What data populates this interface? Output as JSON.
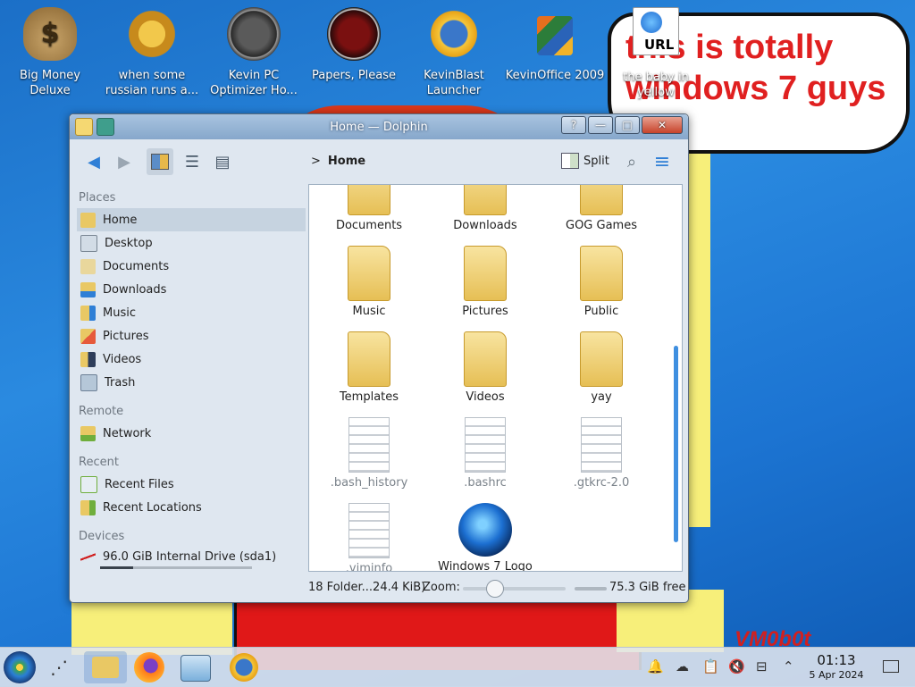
{
  "desktop_icons": [
    {
      "label": "Big Money Deluxe",
      "icon": "money-bag-icon"
    },
    {
      "label": "when some russian runs a...",
      "icon": "gear-icon"
    },
    {
      "label": "Kevin PC Optimizer Ho...",
      "icon": "gauge-icon"
    },
    {
      "label": "Papers, Please",
      "icon": "papers-please-icon"
    },
    {
      "label": "KevinBlast Launcher",
      "icon": "blast-launcher-icon"
    },
    {
      "label": "KevinOffice 2009",
      "icon": "office-icon"
    },
    {
      "label": "the baby in yellow",
      "icon": "url-shortcut-icon"
    }
  ],
  "url_badge": "URL",
  "wallpaper": {
    "bubble_text": "this is totally windows 7 guys",
    "watermark": "VM0b0t"
  },
  "window": {
    "title": "Home — Dolphin",
    "title_buttons": [
      "?",
      "—",
      "□",
      "✕"
    ],
    "breadcrumb_sep": ">",
    "breadcrumb": "Home",
    "split_label": "Split",
    "places": {
      "places_header": "Places",
      "places": [
        {
          "label": "Home",
          "icon": "home-folder-icon",
          "selected": true
        },
        {
          "label": "Desktop",
          "icon": "desktop-icon"
        },
        {
          "label": "Documents",
          "icon": "documents-icon"
        },
        {
          "label": "Downloads",
          "icon": "downloads-icon"
        },
        {
          "label": "Music",
          "icon": "music-icon"
        },
        {
          "label": "Pictures",
          "icon": "pictures-icon"
        },
        {
          "label": "Videos",
          "icon": "videos-icon"
        },
        {
          "label": "Trash",
          "icon": "trash-icon"
        }
      ],
      "remote_header": "Remote",
      "remote": [
        {
          "label": "Network",
          "icon": "network-icon"
        }
      ],
      "recent_header": "Recent",
      "recent": [
        {
          "label": "Recent Files",
          "icon": "recent-files-icon"
        },
        {
          "label": "Recent Locations",
          "icon": "recent-locations-icon"
        }
      ],
      "devices_header": "Devices",
      "devices": [
        {
          "label": "96.0 GiB Internal Drive (sda1)",
          "icon": "drive-icon",
          "usage_fraction": 0.22
        }
      ]
    },
    "files": [
      {
        "name": "Documents",
        "type": "folder"
      },
      {
        "name": "Downloads",
        "type": "folder"
      },
      {
        "name": "GOG Games",
        "type": "folder"
      },
      {
        "name": "Music",
        "type": "folder"
      },
      {
        "name": "Pictures",
        "type": "folder"
      },
      {
        "name": "Public",
        "type": "folder"
      },
      {
        "name": "Templates",
        "type": "folder"
      },
      {
        "name": "Videos",
        "type": "folder"
      },
      {
        "name": "yay",
        "type": "folder"
      },
      {
        "name": ".bash_history",
        "type": "file"
      },
      {
        "name": ".bashrc",
        "type": "file"
      },
      {
        "name": ".gtkrc-2.0",
        "type": "file"
      },
      {
        "name": ".viminfo",
        "type": "file"
      },
      {
        "name": "Windows 7 Logo",
        "type": "logo"
      }
    ],
    "status": {
      "summary": "18 Folder...24.4 KiB)",
      "zoom_label": "Zoom:",
      "free_space": "75.3 GiB free"
    }
  },
  "taskbar": {
    "clock_time": "01:13",
    "clock_date": "5 Apr 2024",
    "apps": [
      {
        "icon": "start-orb-icon"
      },
      {
        "icon": "share-icon"
      },
      {
        "icon": "dolphin-folder-icon",
        "active": true
      },
      {
        "icon": "firefox-icon"
      },
      {
        "icon": "system-monitor-icon"
      },
      {
        "icon": "blast-launcher-icon"
      }
    ]
  }
}
